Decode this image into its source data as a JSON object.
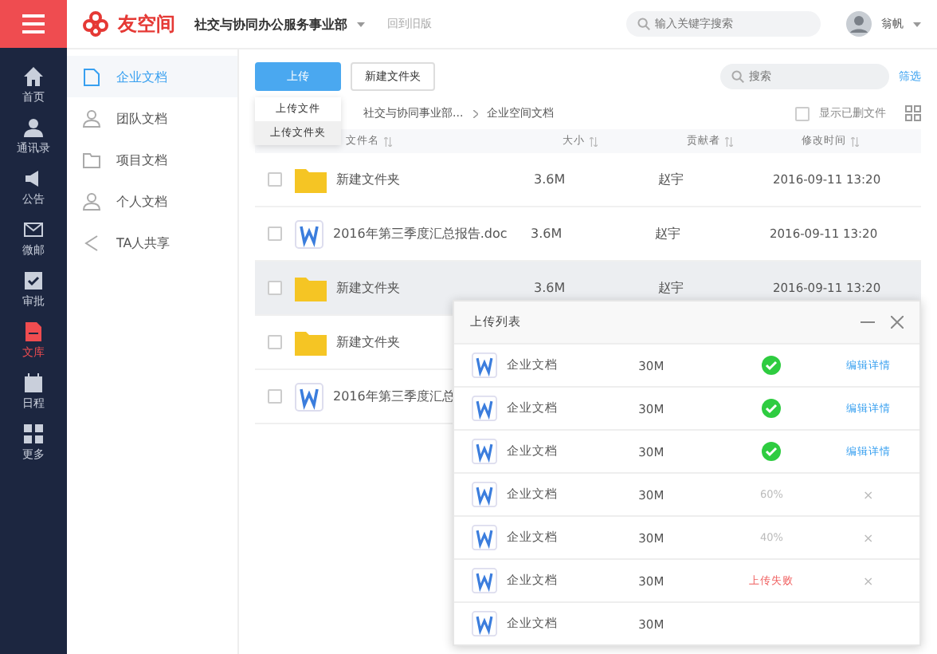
{
  "app": {
    "logo": "友空间",
    "org": "社交与协同办公服务事业部",
    "old_version": "回到旧版",
    "search_placeholder": "输入关键字搜索",
    "user": "翁帆"
  },
  "nav": [
    {
      "label": "首页",
      "selected": false
    },
    {
      "label": "通讯录",
      "selected": false
    },
    {
      "label": "公告",
      "selected": false
    },
    {
      "label": "微邮",
      "selected": false
    },
    {
      "label": "审批",
      "selected": false
    },
    {
      "label": "文库",
      "selected": true
    },
    {
      "label": "日程",
      "selected": false
    },
    {
      "label": "更多",
      "selected": false
    }
  ],
  "sidebar": [
    {
      "label": "企业文档",
      "selected": true
    },
    {
      "label": "团队文档",
      "selected": false
    },
    {
      "label": "项目文档",
      "selected": false
    },
    {
      "label": "个人文档",
      "selected": false
    },
    {
      "label": "TA人共享",
      "selected": false
    }
  ],
  "toolbar": {
    "upload": "上传",
    "new_folder": "新建文件夹",
    "search_placeholder": "搜索",
    "filter": "筛选"
  },
  "upload_menu": [
    {
      "label": "上传文件",
      "selected": false
    },
    {
      "label": "上传文件夹",
      "selected": true
    }
  ],
  "breadcrumb": [
    "社交与协同事业部...",
    "企业空间文档"
  ],
  "show_deleted": {
    "label": "显示已删文件",
    "checked": false
  },
  "table": {
    "columns": [
      "文件名",
      "大小",
      "贡献者",
      "修改时间"
    ],
    "rows": [
      {
        "kind": "folder",
        "name": "新建文件夹",
        "size": "3.6M",
        "contributor": "赵宇",
        "modified": "2016-09-11 13:20",
        "checked": false,
        "selected": false
      },
      {
        "kind": "doc",
        "name": "2016年第三季度汇总报告.doc",
        "size": "3.6M",
        "contributor": "赵宇",
        "modified": "2016-09-11 13:20",
        "checked": false,
        "selected": false
      },
      {
        "kind": "folder",
        "name": "新建文件夹",
        "size": "3.6M",
        "contributor": "赵宇",
        "modified": "2016-09-11 13:20",
        "checked": false,
        "selected": true
      },
      {
        "kind": "folder",
        "name": "新建文件夹",
        "checked": false,
        "selected": false
      },
      {
        "kind": "doc",
        "name": "2016年第三季度汇总",
        "checked": false,
        "selected": false
      }
    ]
  },
  "upload_panel": {
    "title": "上传列表",
    "items": [
      {
        "name": "企业文档",
        "size": "30M",
        "kind": "done",
        "action": "编辑详情"
      },
      {
        "name": "企业文档",
        "size": "30M",
        "kind": "done",
        "action": "编辑详情"
      },
      {
        "name": "企业文档",
        "size": "30M",
        "kind": "done",
        "action": "编辑详情"
      },
      {
        "name": "企业文档",
        "size": "30M",
        "kind": "progress",
        "status": "60%",
        "action": "×"
      },
      {
        "name": "企业文档",
        "size": "30M",
        "kind": "progress",
        "status": "40%",
        "action": "×"
      },
      {
        "name": "企业文档",
        "size": "30M",
        "kind": "failed",
        "status": "上传失败",
        "action": "×"
      },
      {
        "name": "企业文档",
        "size": "30M",
        "kind": "pending"
      }
    ]
  }
}
